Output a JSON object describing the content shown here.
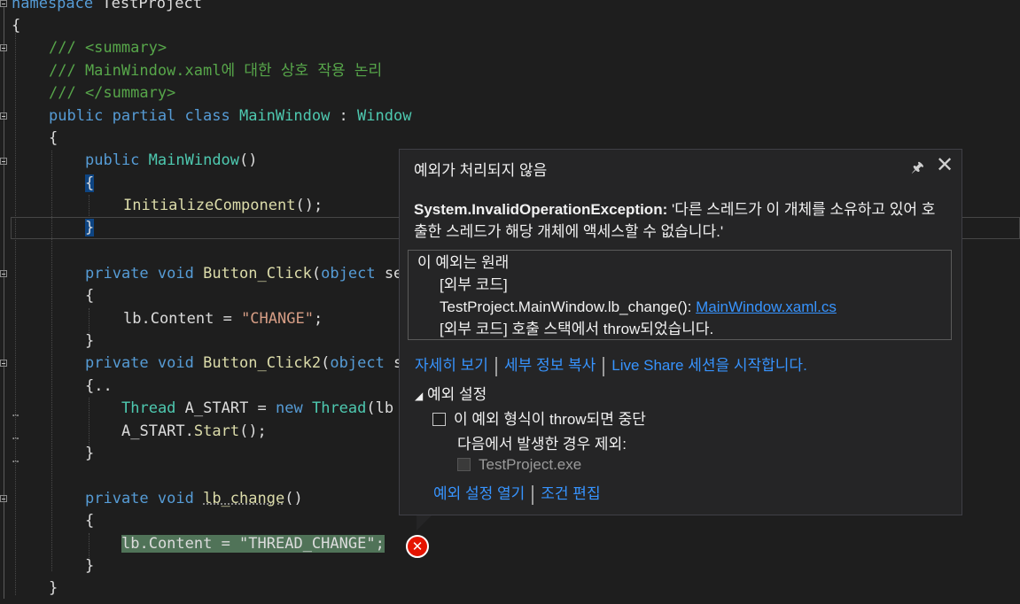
{
  "code": {
    "l0": {
      "kw": "namespace",
      "name": "TestProject"
    },
    "l1": "{",
    "l2": "/// <summary>",
    "l3": "/// MainWindow.xaml에 대한 상호 작용 논리",
    "l4": "/// </summary>",
    "l5": {
      "a": "public partial class",
      "b": "MainWindow",
      "c": " : ",
      "d": "Window"
    },
    "l6": "{",
    "l7": {
      "a": "public",
      "b": "MainWindow",
      "c": "()"
    },
    "l8": "{",
    "l9": {
      "a": "InitializeComponent",
      "b": "();"
    },
    "l10": "}",
    "l11": {
      "a": "private void",
      "b": "Button_Click",
      "c": "(",
      "d": "object",
      "e": " se"
    },
    "l12": "{",
    "l13": {
      "a": "lb.Content = ",
      "b": "\"CHANGE\"",
      "c": ";"
    },
    "l14": "}",
    "l15": {
      "a": "private void",
      "b": "Button_Click2",
      "c": "(",
      "d": "object",
      "e": " s"
    },
    "l16": "{..",
    "l17": {
      "a": "Thread",
      "b": " A_START = ",
      "c": "new",
      "d": " Thread",
      "e": "(lb"
    },
    "l18": {
      "a": "A_START.",
      "b": "Start",
      "c": "();"
    },
    "l19": "}",
    "l20": {
      "a": "private void",
      "b": "lb_change",
      "c": "()"
    },
    "l21": "{",
    "l22": "lb.Content = \"THREAD_CHANGE\";",
    "l23": "}",
    "l24": "}"
  },
  "popup": {
    "title": "예외가 처리되지 않음",
    "pin": "pin-icon",
    "close": "close-icon",
    "exception_type": "System.InvalidOperationException:",
    "exception_msg": " '다른 스레드가 이 개체를 소유하고 있어 호출한 스레드가 해당 개체에 액세스할 수 없습니다.'",
    "trace_head": "이 예외는 원래",
    "trace_ext1": "[외부 코드]",
    "trace_frame": "TestProject.MainWindow.lb_change(): ",
    "trace_file": "MainWindow.xaml.cs",
    "trace_ext2": "[외부 코드] 호출 스택에서 throw되었습니다.",
    "link_details": "자세히 보기",
    "link_copy": "세부 정보 복사",
    "link_liveshare": "Live Share 세션을 시작합니다.",
    "section": "예외 설정",
    "break_label": "이 예외 형식이 throw되면 중단",
    "except_label": "다음에서 발생한 경우 제외:",
    "process": "TestProject.exe",
    "link_open": "예외 설정 열기",
    "link_edit": "조건 편집"
  }
}
